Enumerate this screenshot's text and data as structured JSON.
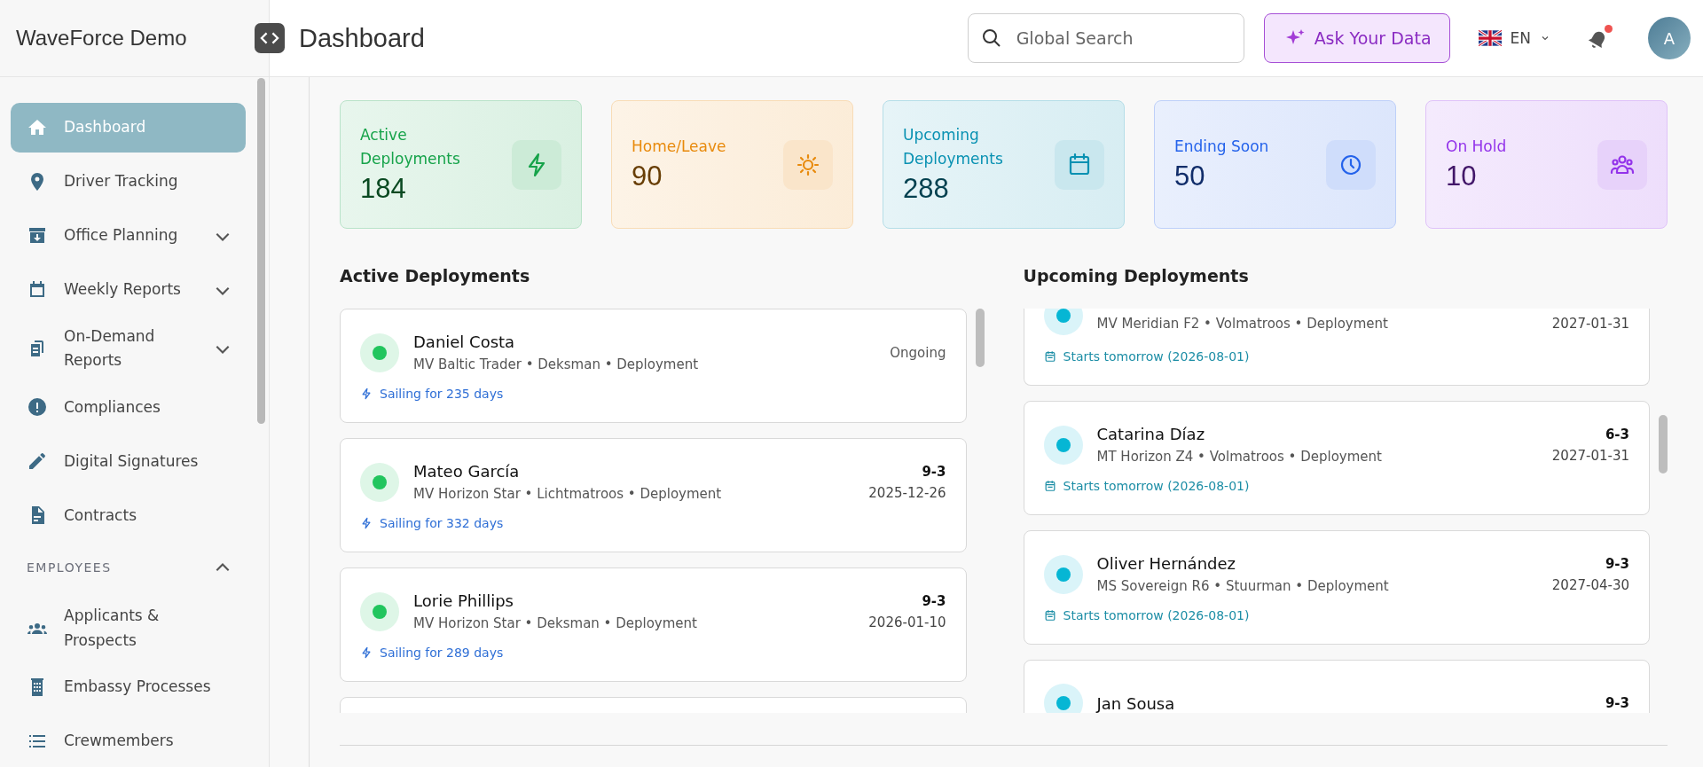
{
  "sidebar": {
    "logo": "WaveForce Demo",
    "items": [
      {
        "label": "Dashboard",
        "selected": true
      },
      {
        "label": "Driver Tracking",
        "selected": false
      },
      {
        "label": "Office Planning",
        "selected": false,
        "expanded": false
      },
      {
        "label": "Weekly Reports",
        "selected": false,
        "expanded": false
      },
      {
        "label": "On-Demand Reports",
        "selected": false,
        "expanded": false
      },
      {
        "label": "Compliances",
        "selected": false
      },
      {
        "label": "Digital Signatures",
        "selected": false
      },
      {
        "label": "Contracts",
        "selected": false
      }
    ],
    "section": {
      "title": "EMPLOYEES",
      "expanded": true,
      "items": [
        {
          "label": "Applicants & Prospects",
          "selected": false
        },
        {
          "label": "Embassy Processes",
          "selected": false
        },
        {
          "label": "Crewmembers",
          "selected": false
        }
      ]
    }
  },
  "header": {
    "title": "Dashboard",
    "search": {
      "placeholder": "Global Search"
    },
    "ask_button": "Ask Your Data",
    "language": "EN",
    "notification": true,
    "avatar": "A"
  },
  "stats": [
    {
      "kind": "bolt",
      "label": "Active Deployments",
      "value": "184",
      "color": "#16a34a"
    },
    {
      "kind": "sun",
      "label": "Home/Leave",
      "value": "90",
      "color": "#e88a0c"
    },
    {
      "kind": "calendar",
      "label": "Upcoming Deployments",
      "value": "288",
      "color": "#0891b2"
    },
    {
      "kind": "clock",
      "label": "Ending Soon",
      "value": "50",
      "color": "#2563eb"
    },
    {
      "kind": "people",
      "label": "On Hold",
      "value": "10",
      "color": "#9333ea"
    }
  ],
  "active": {
    "title": "Active Deployments",
    "items": [
      {
        "name": "Daniel Costa",
        "meta": "MV Baltic Trader • Deksman • Deployment",
        "status": "Ongoing",
        "footer": "Sailing for 235 days",
        "color": "#22c55e"
      },
      {
        "name": "Mateo García",
        "meta": "MV Horizon Star • Lichtmatroos • Deployment",
        "rotation": "9-3",
        "date": "2025-12-26",
        "footer": "Sailing for 332 days",
        "color": "#22c55e"
      },
      {
        "name": "Lorie Phillips",
        "meta": "MV Horizon Star • Deksman • Deployment",
        "rotation": "9-3",
        "date": "2026-01-10",
        "footer": "Sailing for 289 days",
        "color": "#22c55e"
      }
    ]
  },
  "upcoming": {
    "title": "Upcoming Deployments",
    "items": [
      {
        "meta": "MV Meridian F2 • Volmatroos • Deployment",
        "date": "2027-01-31",
        "footer": "Starts tomorrow (2026-08-01)",
        "color": "#06b6d4"
      },
      {
        "name": "Catarina Díaz",
        "meta": "MT Horizon Z4 • Volmatroos • Deployment",
        "rotation": "6-3",
        "date": "2027-01-31",
        "footer": "Starts tomorrow (2026-08-01)",
        "color": "#06b6d4"
      },
      {
        "name": "Oliver Hernández",
        "meta": "MS Sovereign R6 • Stuurman • Deployment",
        "rotation": "9-3",
        "date": "2027-04-30",
        "footer": "Starts tomorrow (2026-08-01)",
        "color": "#06b6d4"
      },
      {
        "name": "Jan Sousa",
        "rotation": "9-3",
        "color": "#06b6d4"
      }
    ]
  }
}
